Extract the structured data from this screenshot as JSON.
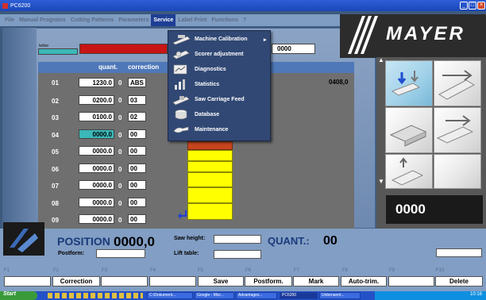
{
  "window": {
    "title": "PC6200"
  },
  "menu": [
    {
      "label": "File"
    },
    {
      "label": "Manual Programs"
    },
    {
      "label": "Cutting Patterns"
    },
    {
      "label": "Parameters"
    },
    {
      "label": "Service"
    },
    {
      "label": "Label Print"
    },
    {
      "label": "Functions"
    },
    {
      "label": "?"
    }
  ],
  "dropdown": [
    {
      "label": "Machine Calibration",
      "arrow": "▸"
    },
    {
      "label": "Scorer adjustment"
    },
    {
      "label": "Diagnostics"
    },
    {
      "label": "Statistics"
    },
    {
      "label": "Saw Carriage Feed"
    },
    {
      "label": "Database"
    },
    {
      "label": "Maintenance"
    }
  ],
  "header": {
    "letter_label": "letter",
    "top_value": "0000",
    "col_quant": "quant.",
    "col_correction": "correction",
    "right_value": "0408,0"
  },
  "rows": [
    {
      "num": "01",
      "value": "1230.0",
      "small": "0",
      "unit": "ABS"
    },
    {
      "num": "02",
      "value": "0200.0",
      "small": "0",
      "unit": "03"
    },
    {
      "num": "03",
      "value": "0100.0",
      "small": "0",
      "unit": "02"
    },
    {
      "num": "04",
      "value": "0000.0",
      "small": "0",
      "unit": "00"
    },
    {
      "num": "05",
      "value": "0000.0",
      "small": "0",
      "unit": "00"
    },
    {
      "num": "06",
      "value": "0000.0",
      "small": "0",
      "unit": "00"
    },
    {
      "num": "07",
      "value": "0000.0",
      "small": "0",
      "unit": "00"
    },
    {
      "num": "08",
      "value": "0000.0",
      "small": "0",
      "unit": "00"
    },
    {
      "num": "09",
      "value": "0000.0",
      "small": "0",
      "unit": "00"
    }
  ],
  "brand": "MAYER",
  "counter": "0000",
  "status": {
    "position_label": "POSITION",
    "position_value": "0000,0",
    "postform_label": "Postform:",
    "saw_height_label": "Saw height:",
    "lift_table_label": "Lift table:",
    "quant_label": "QUANT.:",
    "quant_value": "00"
  },
  "fkeys": [
    "F1",
    "F2",
    "F3",
    "F4",
    "F5",
    "F6",
    "F7",
    "F8",
    "F9",
    "F10"
  ],
  "fbuttons": {
    "f2": "Correction",
    "f5": "Save",
    "f6": "Postform.",
    "f7": "Mark",
    "f8": "Auto-trim.",
    "f10": "Delete"
  },
  "taskbar": {
    "start": "Start",
    "items": [
      "C:\\Dokument...",
      "Google - Micr...",
      "Advantages...",
      "PC6200",
      "Unbenannt..."
    ],
    "clock": "10:18"
  },
  "colors": {
    "highlight_cell": "#3bb8b8",
    "dropdown_bg": "#314874",
    "menu_active": "#1d3e94"
  }
}
